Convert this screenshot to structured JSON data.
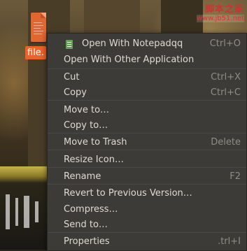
{
  "desktop": {
    "file_label": "file.",
    "watermark": {
      "title": "脚本之家",
      "url": "www.jb51.net"
    }
  },
  "context_menu": {
    "items": [
      {
        "label": "Open With Notepadqq",
        "shortcut": "Ctrl+O",
        "icon": "notepadqq-icon"
      },
      {
        "label": "Open With Other Application",
        "shortcut": ""
      },
      {
        "label": "Cut",
        "shortcut": "Ctrl+X"
      },
      {
        "label": "Copy",
        "shortcut": "Ctrl+C"
      },
      {
        "label": "Move to…",
        "shortcut": ""
      },
      {
        "label": "Copy to…",
        "shortcut": ""
      },
      {
        "label": "Move to Trash",
        "shortcut": "Delete"
      },
      {
        "label": "Resize Icon…",
        "shortcut": ""
      },
      {
        "label": "Rename",
        "shortcut": "F2"
      },
      {
        "label": "Revert to Previous Version…",
        "shortcut": ""
      },
      {
        "label": "Compress…",
        "shortcut": ""
      },
      {
        "label": "Send to…",
        "shortcut": ""
      },
      {
        "label": "Properties",
        "shortcut": ".trl+I"
      }
    ]
  }
}
